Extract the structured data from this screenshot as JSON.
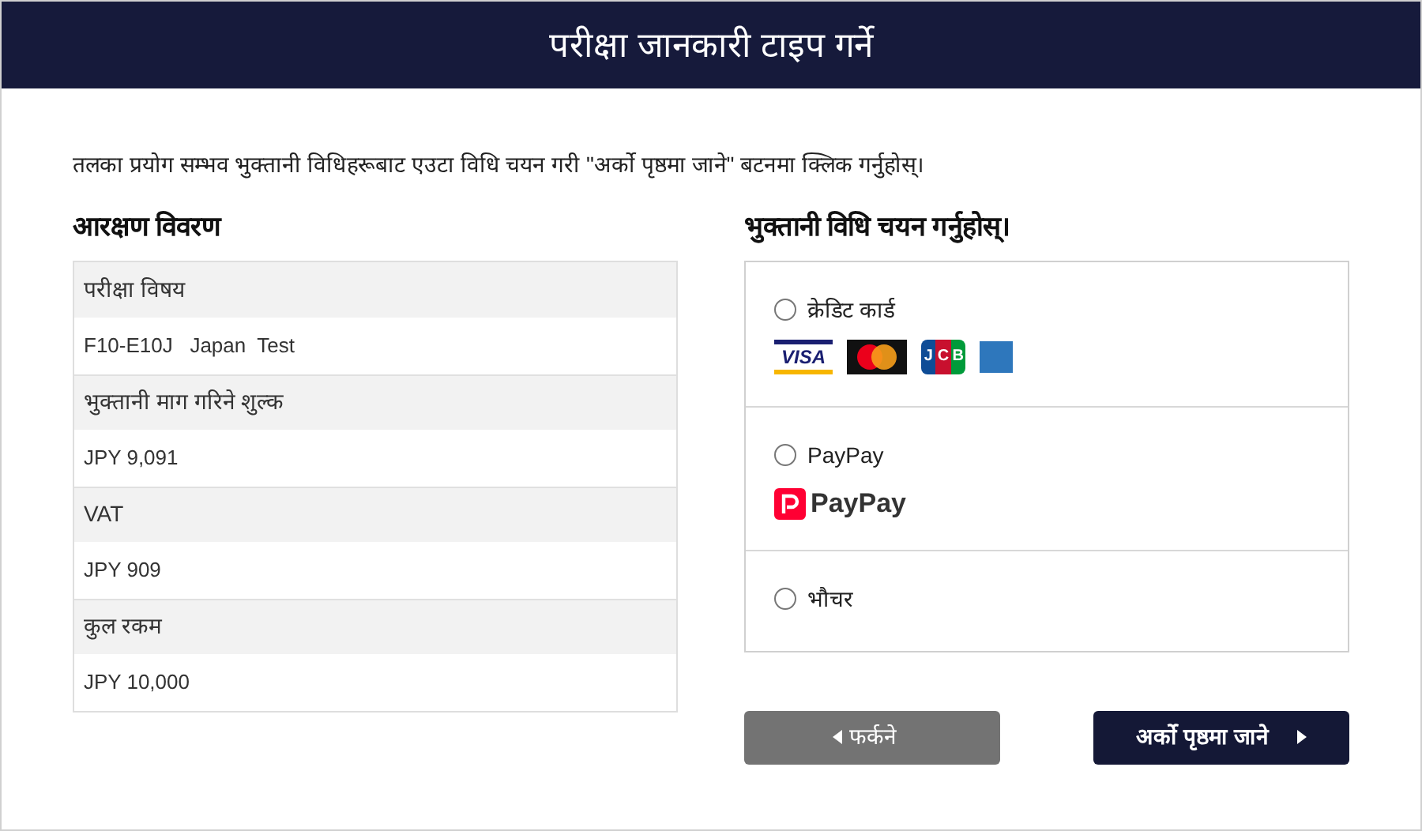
{
  "header": {
    "title": "परीक्षा जानकारी टाइप गर्ने"
  },
  "instruction": "तलका प्रयोग सम्भव भुक्तानी विधिहरूबाट एउटा विधि चयन गरी \"अर्को पृष्ठमा जाने\" बटनमा क्लिक गर्नुहोस्।",
  "booking": {
    "title": "आरक्षण विवरण",
    "rows": [
      {
        "label": "परीक्षा विषय",
        "value": "F10-E10J   Japan  Test"
      },
      {
        "label": "भुक्तानी माग गरिने शुल्क",
        "value": "JPY 9,091"
      },
      {
        "label": "VAT",
        "value": "JPY 909"
      },
      {
        "label": "कुल रकम",
        "value": "JPY 10,000"
      }
    ]
  },
  "payment": {
    "title": "भुक्तानी विधि चयन गर्नुहोस्।",
    "methods": [
      {
        "label": "क्रेडिट कार्ड",
        "selected": false,
        "kind": "cards",
        "logos": [
          {
            "kind": "visa",
            "text": "VISA"
          },
          {
            "kind": "mastercard"
          },
          {
            "kind": "jcb",
            "text": "JCB"
          },
          {
            "kind": "amex"
          }
        ]
      },
      {
        "label": "PayPay",
        "selected": false,
        "kind": "paypay",
        "logo_text": "PayPay"
      },
      {
        "label": "भौचर",
        "selected": false,
        "kind": "plain"
      }
    ]
  },
  "buttons": [
    {
      "kind": "back",
      "label": "फर्कने"
    },
    {
      "kind": "next",
      "label": "अर्को पृष्ठमा जाने"
    }
  ]
}
